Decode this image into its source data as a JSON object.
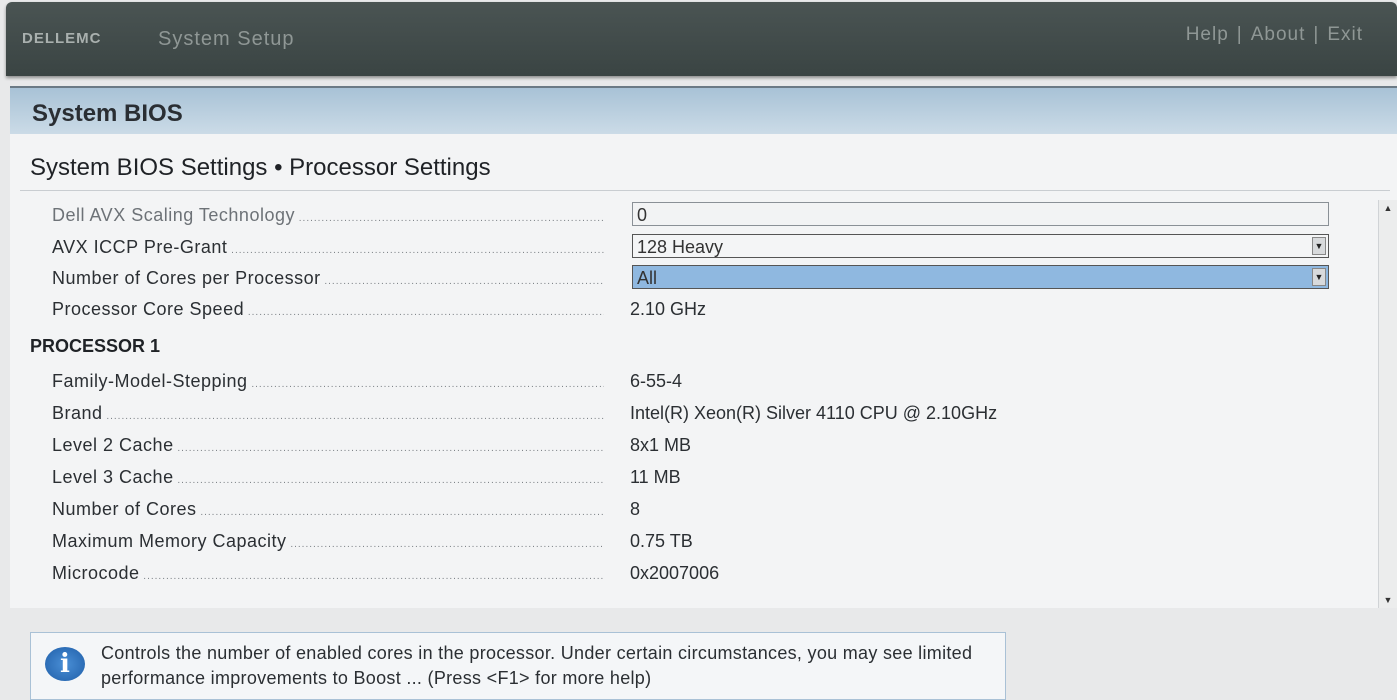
{
  "topbar": {
    "brand": "DELLEMC",
    "app_title": "System Setup",
    "links": [
      "Help",
      "About",
      "Exit"
    ]
  },
  "page": {
    "title": "System BIOS",
    "subtitle": "System BIOS Settings • Processor Settings"
  },
  "settings": {
    "avx_scaling": {
      "label": "Dell AVX Scaling Technology",
      "value": "0"
    },
    "avx_iccp": {
      "label": "AVX ICCP Pre-Grant",
      "value": "128 Heavy"
    },
    "cores_per_processor": {
      "label": "Number of Cores per Processor",
      "value": "All"
    },
    "core_speed": {
      "label": "Processor Core Speed",
      "value": "2.10 GHz"
    }
  },
  "processor1": {
    "title": "PROCESSOR 1",
    "rows": [
      {
        "label": "Family-Model-Stepping",
        "value": "6-55-4"
      },
      {
        "label": "Brand",
        "value": "Intel(R) Xeon(R) Silver 4110 CPU @ 2.10GHz"
      },
      {
        "label": "Level 2 Cache",
        "value": "8x1 MB"
      },
      {
        "label": "Level 3 Cache",
        "value": "11 MB"
      },
      {
        "label": "Number of Cores",
        "value": "8"
      },
      {
        "label": "Maximum Memory Capacity",
        "value": "0.75 TB"
      },
      {
        "label": "Microcode",
        "value": "0x2007006"
      }
    ]
  },
  "help": {
    "text": "Controls the number of enabled cores in the processor. Under certain circumstances, you may see limited performance improvements to Boost ... (Press <F1> for more help)"
  },
  "icons": {
    "info": "info-icon",
    "dropdown": "chevron-down-icon",
    "scroll_up": "scroll-up-icon",
    "scroll_down": "scroll-down-icon"
  },
  "colors": {
    "topbar": "#3f4948",
    "header": "#b6cddf",
    "selected": "#8fb8e0"
  }
}
